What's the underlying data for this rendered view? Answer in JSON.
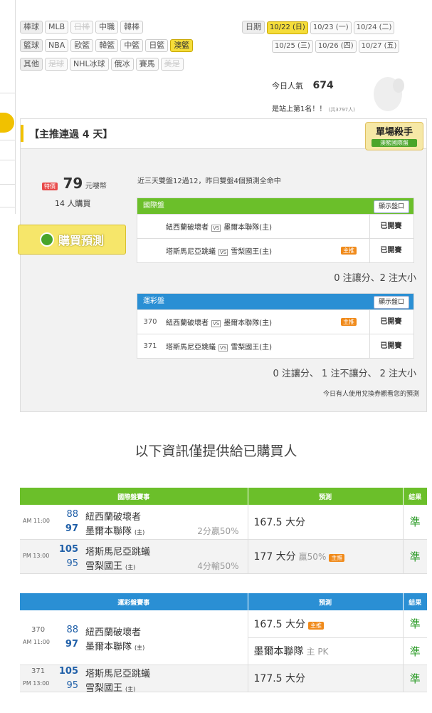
{
  "sports": {
    "baseball_label": "棒球",
    "baseball": [
      {
        "t": "MLB",
        "d": false
      },
      {
        "t": "日棒",
        "d": true
      },
      {
        "t": "中職",
        "d": false
      },
      {
        "t": "韓棒",
        "d": false
      }
    ],
    "basketball_label": "籃球",
    "basketball": [
      {
        "t": "NBA",
        "d": false
      },
      {
        "t": "歐籃",
        "d": false
      },
      {
        "t": "韓籃",
        "d": false
      },
      {
        "t": "中籃",
        "d": false
      },
      {
        "t": "日籃",
        "d": false
      },
      {
        "t": "澳籃",
        "d": false,
        "h": true
      }
    ],
    "other_label": "其他",
    "other": [
      {
        "t": "足球",
        "d": true
      },
      {
        "t": "NHL冰球",
        "d": false
      },
      {
        "t": "俄冰",
        "d": false
      },
      {
        "t": "賽馬",
        "d": false
      },
      {
        "t": "美足",
        "d": true
      }
    ]
  },
  "dates": {
    "label": "日期",
    "row1": [
      "10/22 (日)",
      "10/23 (一)",
      "10/24 (二)"
    ],
    "row2": [
      "10/25 (三)",
      "10/26 (四)",
      "10/27 (五)"
    ]
  },
  "popularity": {
    "label": "今日人氣",
    "value": "674",
    "rank": "是站上第1名！！",
    "total": "(共3797人)"
  },
  "promo": {
    "title": "【主推連過 4 天】",
    "badge_top": "單場殺手",
    "badge_sub": "澳籃國際盤",
    "special": "特價",
    "price": "79",
    "unit": "元嘍幣",
    "buyers": "14 人購買",
    "buy_button": "購買預測",
    "summary": "近三天雙盤12過12，昨日雙盤4個預測全命中",
    "intl": {
      "title": "國際盤",
      "show": "顯示盤口",
      "rows": [
        {
          "num": "",
          "away": "紐西蘭破壞者",
          "home": "墨爾本聯隊(主)",
          "main": false,
          "status": "已開賽"
        },
        {
          "num": "",
          "away": "塔斯馬尼亞跳蟻",
          "home": "雪梨國王(主)",
          "main": true,
          "status": "已開賽"
        }
      ],
      "footer": "0 注讓分、2 注大小"
    },
    "lottery": {
      "title": "運彩盤",
      "show": "顯示盤口",
      "rows": [
        {
          "num": "370",
          "away": "紐西蘭破壞者",
          "home": "墨爾本聯隊(主)",
          "main": true,
          "status": "已開賽"
        },
        {
          "num": "371",
          "away": "塔斯馬尼亞跳蟻",
          "home": "雪梨國王(主)",
          "main": false,
          "status": "已開賽"
        }
      ],
      "footer": "0 注讓分、 1 注不讓分、 2 注大小"
    },
    "note": "今日有人使用兌換券觀看您的預測",
    "main_tag": "主推",
    "vs": "VS"
  },
  "info_heading": "以下資訊僅提供給已購買人",
  "result_intl": {
    "headers": [
      "國際盤賽事",
      "預測",
      "結果"
    ],
    "rows": [
      {
        "time": "AM 11:00",
        "s1": "88",
        "t1": "紐西蘭破壞者",
        "s2": "97",
        "t2": "墨爾本聯隊",
        "home": "(主)",
        "spread": "2分贏50%",
        "pred": "167.5 大分",
        "extra": "",
        "main": false,
        "result": "準"
      },
      {
        "time": "PM 13:00",
        "s1": "105",
        "t1": "塔斯馬尼亞跳蟻",
        "s2": "95",
        "t2": "雪梨國王",
        "home": "(主)",
        "spread": "4分輸50%",
        "pred": "177 大分",
        "extra": "贏50%",
        "main": true,
        "result": "準"
      }
    ]
  },
  "result_lottery": {
    "headers": [
      "運彩盤賽事",
      "預測",
      "結果"
    ],
    "rows": [
      {
        "num": "370",
        "time": "AM 11:00",
        "s1": "88",
        "t1": "紐西蘭破壞者",
        "s2": "97",
        "t2": "墨爾本聯隊",
        "home": "(主)",
        "preds": [
          {
            "p": "167.5 大分",
            "extra": "",
            "main": true,
            "r": "準"
          },
          {
            "p": "墨爾本聯隊",
            "extra": "主 PK",
            "main": false,
            "r": "準"
          }
        ]
      },
      {
        "num": "371",
        "time": "PM 13:00",
        "s1": "105",
        "t1": "塔斯馬尼亞跳蟻",
        "s2": "95",
        "t2": "雪梨國王",
        "home": "(主)",
        "preds": [
          {
            "p": "177.5 大分",
            "extra": "",
            "main": false,
            "r": "準"
          }
        ]
      }
    ]
  },
  "colors": {
    "green_header": "#6bbf2a",
    "blue_header": "#2a8fd4",
    "result_green": "#2e9c2a",
    "score_blue": "#1f5fa8"
  }
}
